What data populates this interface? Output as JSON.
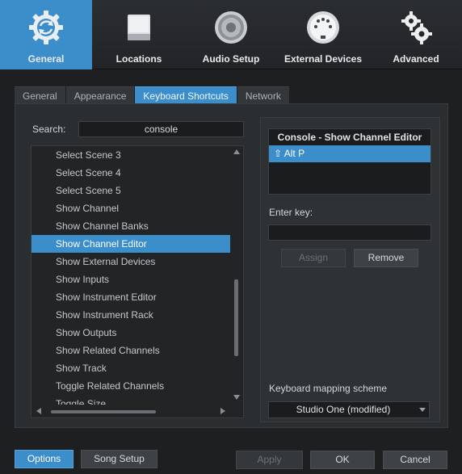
{
  "toolbar": {
    "categories": [
      {
        "label": "General",
        "icon": "gear-cycle-icon",
        "active": true
      },
      {
        "label": "Locations",
        "icon": "drive-icon"
      },
      {
        "label": "Audio Setup",
        "icon": "speaker-icon"
      },
      {
        "label": "External Devices",
        "icon": "midi-connector-icon"
      },
      {
        "label": "Advanced",
        "icon": "gears-icon"
      }
    ]
  },
  "tabs": [
    {
      "label": "General"
    },
    {
      "label": "Appearance"
    },
    {
      "label": "Keyboard Shortcuts",
      "active": true
    },
    {
      "label": "Network"
    }
  ],
  "search": {
    "label": "Search:",
    "value": "console"
  },
  "commands": [
    "Select Scene 3",
    "Select Scene 4",
    "Select Scene 5",
    "Show Channel",
    "Show Channel Banks",
    "Show Channel Editor",
    "Show External Devices",
    "Show Inputs",
    "Show Instrument Editor",
    "Show Instrument Rack",
    "Show Outputs",
    "Show Related Channels",
    "Show Track",
    "Toggle Related Channels",
    "Toggle Size"
  ],
  "selected_command": "Show Channel Editor",
  "shortcut_panel": {
    "title": "Console - Show Channel Editor",
    "assigned_key": "⇧ Alt P",
    "enter_key_label": "Enter key:",
    "enter_key_value": "",
    "assign_label": "Assign",
    "remove_label": "Remove",
    "scheme_label": "Keyboard mapping scheme",
    "scheme_value": "Studio One (modified)"
  },
  "footer": {
    "options_label": "Options",
    "song_setup_label": "Song Setup",
    "apply_label": "Apply",
    "ok_label": "OK",
    "cancel_label": "Cancel"
  },
  "colors": {
    "accent": "#3c8ecb",
    "background": "#1d1f21",
    "panel": "#2b2e31"
  }
}
